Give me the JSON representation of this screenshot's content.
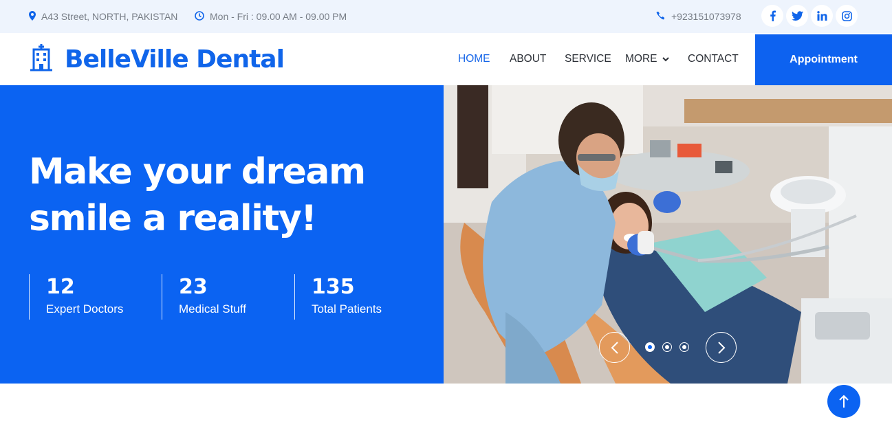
{
  "topbar": {
    "address": "A43 Street, NORTH, PAKISTAN",
    "hours": "Mon - Fri : 09.00 AM - 09.00 PM",
    "phone": "+923151073978",
    "socials": [
      "facebook-icon",
      "twitter-icon",
      "linkedin-icon",
      "instagram-icon"
    ]
  },
  "brand": {
    "name": "BelleVille Dental",
    "icon": "hospital-building-icon"
  },
  "nav": {
    "home": "HOME",
    "about": "ABOUT",
    "service": "SERVICE",
    "more": "MORE",
    "contact": "CONTACT",
    "appointment": "Appointment"
  },
  "hero": {
    "headline_line1": "Make your dream",
    "headline_line2": "smile a reality!",
    "stats": [
      {
        "value": "12",
        "label": "Expert Doctors"
      },
      {
        "value": "23",
        "label": "Medical Stuff"
      },
      {
        "value": "135",
        "label": "Total Patients"
      }
    ],
    "carousel": {
      "slides": 3,
      "active_index": 0
    }
  },
  "colors": {
    "primary": "#0b63f2",
    "topbar_bg": "#eef4fd",
    "nav_text": "#2b2f36",
    "muted_text": "#777d86"
  }
}
